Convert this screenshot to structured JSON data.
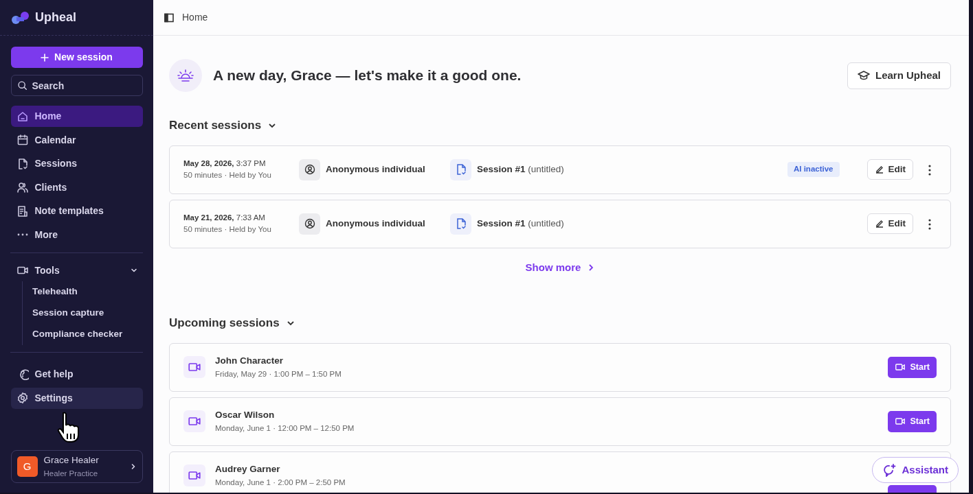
{
  "brand": "Upheal",
  "sidebar": {
    "new_session": "New session",
    "search": {
      "placeholder": "Search"
    },
    "items": [
      {
        "label": "Home",
        "selected": true,
        "hovered": false
      },
      {
        "label": "Calendar",
        "selected": false,
        "hovered": false
      },
      {
        "label": "Sessions",
        "selected": false,
        "hovered": false
      },
      {
        "label": "Clients",
        "selected": false,
        "hovered": false
      },
      {
        "label": "Note templates",
        "selected": false,
        "hovered": false
      },
      {
        "label": "More",
        "selected": false,
        "hovered": false
      }
    ],
    "tools": {
      "label": "Tools",
      "expanded": true,
      "children": [
        {
          "label": "Telehealth"
        },
        {
          "label": "Session capture"
        },
        {
          "label": "Compliance checker"
        }
      ]
    },
    "footer_items": [
      {
        "label": "Get help",
        "selected": false,
        "hovered": false
      },
      {
        "label": "Settings",
        "selected": false,
        "hovered": true
      }
    ],
    "user": {
      "initial": "G",
      "name": "Grace Healer",
      "practice": "Healer Practice"
    }
  },
  "breadcrumb": "Home",
  "greeting": "A new day, Grace — let's make it a good one.",
  "learn_button": "Learn Upheal",
  "recent": {
    "title": "Recent sessions",
    "expanded": true,
    "rows": [
      {
        "date": "May 28, 2026,",
        "time": "3:37 PM",
        "meta": "50 minutes · Held by You",
        "client": "Anonymous individual",
        "session": "Session #1",
        "note": "(untitled)",
        "badge": "AI inactive",
        "edit": "Edit"
      },
      {
        "date": "May 21, 2026,",
        "time": "7:33 AM",
        "meta": "50 minutes · Held by You",
        "client": "Anonymous individual",
        "session": "Session #1",
        "note": "(untitled)",
        "edit": "Edit"
      }
    ],
    "show_more": "Show more"
  },
  "upcoming": {
    "title": "Upcoming sessions",
    "expanded": true,
    "rows": [
      {
        "name": "John Character",
        "when": "Friday, May 29 · 1:00 PM – 1:50 PM",
        "start": "Start"
      },
      {
        "name": "Oscar Wilson",
        "when": "Monday, June 1 · 12:00 PM – 12:50 PM",
        "start": "Start"
      },
      {
        "name": "Audrey Garner",
        "when": "Monday, June 1 · 2:00 PM – 2:50 PM"
      }
    ]
  },
  "assistant": "Assistant"
}
